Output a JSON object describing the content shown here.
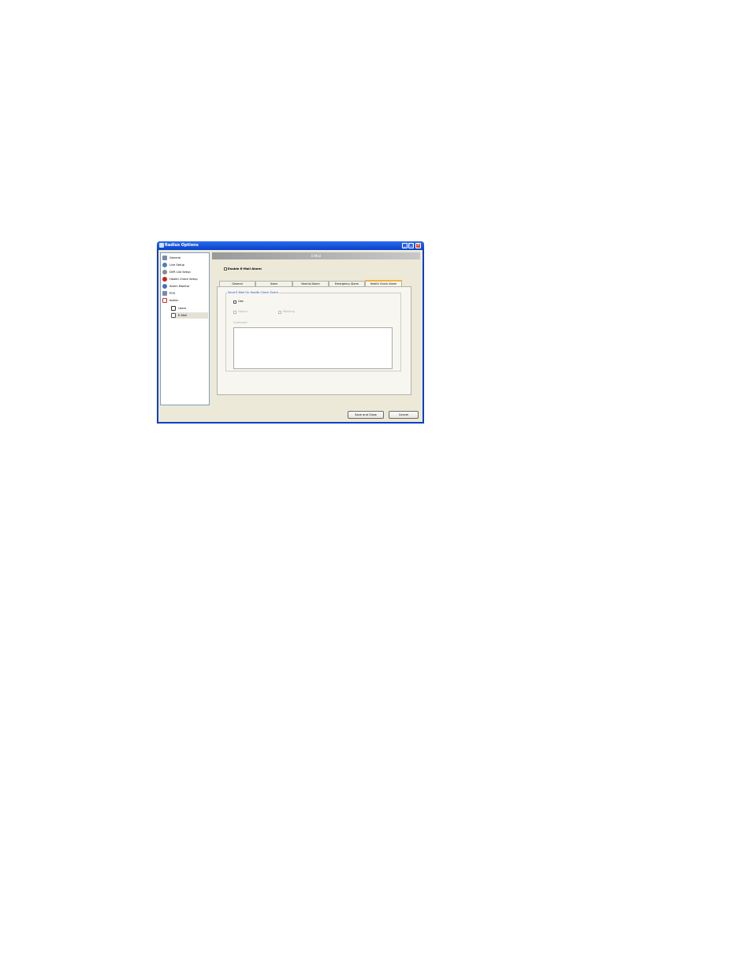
{
  "window": {
    "title": "Radius Options"
  },
  "sidebar": {
    "items": [
      {
        "label": "General",
        "icon": "wrench-icon",
        "color": "#7a8aa8"
      },
      {
        "label": "Live Setup",
        "icon": "camera-icon",
        "color": "#4a7fc0"
      },
      {
        "label": "DVR List Setup",
        "icon": "dvr-icon",
        "color": "#8a8a8a"
      },
      {
        "label": "Health Check Setup",
        "icon": "heart-icon",
        "color": "#d02020"
      },
      {
        "label": "Alarm Monitor",
        "icon": "alarm-icon",
        "color": "#4a6fb0"
      },
      {
        "label": "POS",
        "icon": "pos-icon",
        "color": "#7a8aa8"
      },
      {
        "label": "Admin",
        "icon": "admin-icon",
        "color": "#c03030"
      },
      {
        "label": "Users",
        "icon": "users-icon",
        "color": "#333333"
      },
      {
        "label": "E-Mail",
        "icon": "email-icon",
        "color": "#555555"
      }
    ]
  },
  "main": {
    "header": "E-Mail",
    "enable_label": "Enable E-Mail Alarm",
    "tabs": [
      "General",
      "Users",
      "Normal Alarm",
      "Emergency Alarm",
      "Health Check Alarm"
    ],
    "active_tab": "Health Check Alarm",
    "group_title": "Send E-Mail On Health Check Event",
    "use_label": "Use",
    "failure_label": "Failure",
    "warning_label": "Warning",
    "comment_label": "Comment"
  },
  "footer": {
    "save_label": "Save and Close",
    "cancel_label": "Cancel"
  },
  "colors": {
    "title_bar": "#0842c9",
    "active_tab_accent": "#f2b23a",
    "group_title": "#1d50c8"
  }
}
